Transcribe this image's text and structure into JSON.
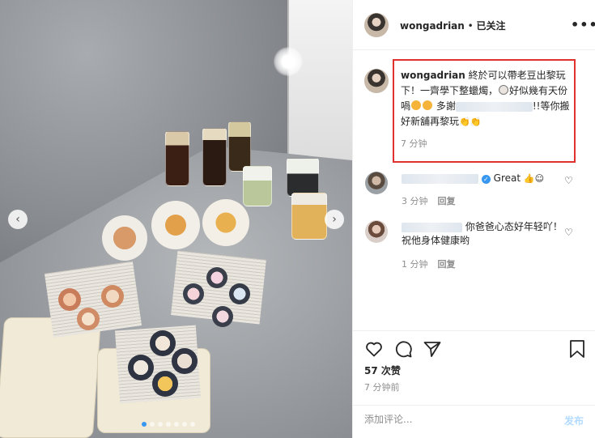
{
  "colors": {
    "highlight": "#e0312f",
    "link": "#3897f0",
    "muted": "#8e8e8e",
    "post_disabled": "#b3dbff"
  },
  "header": {
    "username": "wongadrian",
    "separator": " • ",
    "status": "已关注",
    "more_icon": "more-horizontal-icon"
  },
  "caption": {
    "username": "wongadrian",
    "text_1": "終於可以帶老豆出黎玩下！一齊學下整蠟燭，",
    "text_2": "好似幾有天份喎",
    "text_3": "多謝",
    "text_4": "!!等你搬好新舖再黎玩",
    "time": "7 分钟"
  },
  "comments": [
    {
      "text": "Great",
      "time": "3 分钟",
      "reply": "回复",
      "verified": true
    },
    {
      "text": "你爸爸心态好年轻吖！祝他身体健康哟",
      "time": "1 分钟",
      "reply": "回复",
      "verified": false
    }
  ],
  "actions": {
    "icons": [
      "heart-icon",
      "comment-icon",
      "share-icon",
      "bookmark-icon"
    ]
  },
  "likes": "57 次赞",
  "posted": "7 分钟前",
  "add_comment": {
    "placeholder": "添加评论...",
    "post_label": "发布"
  },
  "carousel": {
    "slide_count": 7,
    "current_slide": 1
  }
}
